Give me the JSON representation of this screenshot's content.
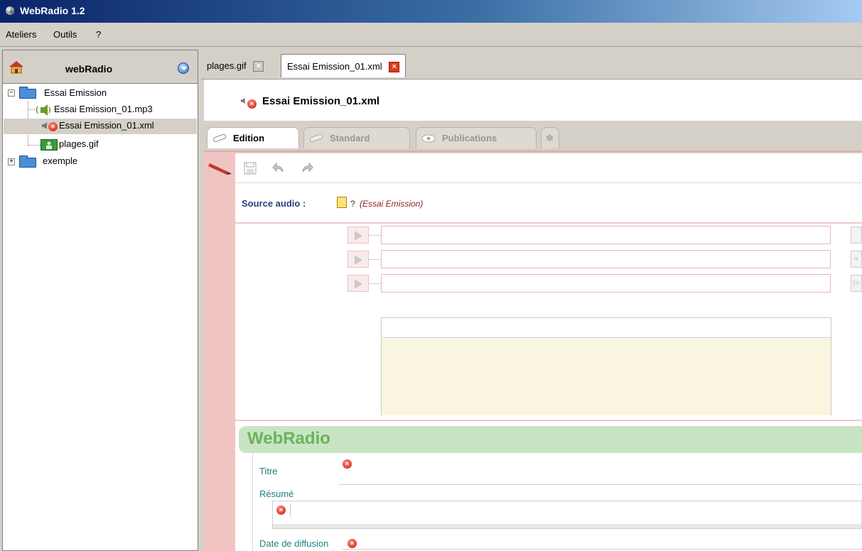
{
  "window": {
    "title": "WebRadio 1.2"
  },
  "menu": {
    "items": [
      "Ateliers",
      "Outils",
      "?"
    ]
  },
  "left_panel": {
    "title": "webRadio",
    "tree": [
      {
        "label": "Essai Emission",
        "level": 0,
        "expanded": true
      },
      {
        "label": "Essai Emission_01.mp3",
        "level": 1
      },
      {
        "label": "Essai Emission_01.xml",
        "level": 1,
        "selected": true
      },
      {
        "label": "plages.gif",
        "level": 1
      },
      {
        "label": "exemple",
        "level": 0,
        "expanded": false
      }
    ]
  },
  "doc_tabs": [
    {
      "label": "plages.gif",
      "active": false
    },
    {
      "label": "Essai Emission_01.xml",
      "active": true
    }
  ],
  "document": {
    "title": "Essai Emission_01.xml"
  },
  "view_tabs": [
    {
      "label": "Edition",
      "active": true
    },
    {
      "label": "Standard",
      "active": false
    },
    {
      "label": "Publications",
      "active": false
    }
  ],
  "editor": {
    "source_label": "Source audio :",
    "source_value_prefix": "?",
    "source_value": "(Essai Emission)",
    "section_title": "WebRadio",
    "fields": {
      "titre": "Titre",
      "resume": "Résumé",
      "date": "Date de diffusion"
    }
  },
  "colors": {
    "accent_pink": "#f2c3c3",
    "section_green": "#c9e4c5",
    "label_teal": "#1f7f7f"
  }
}
